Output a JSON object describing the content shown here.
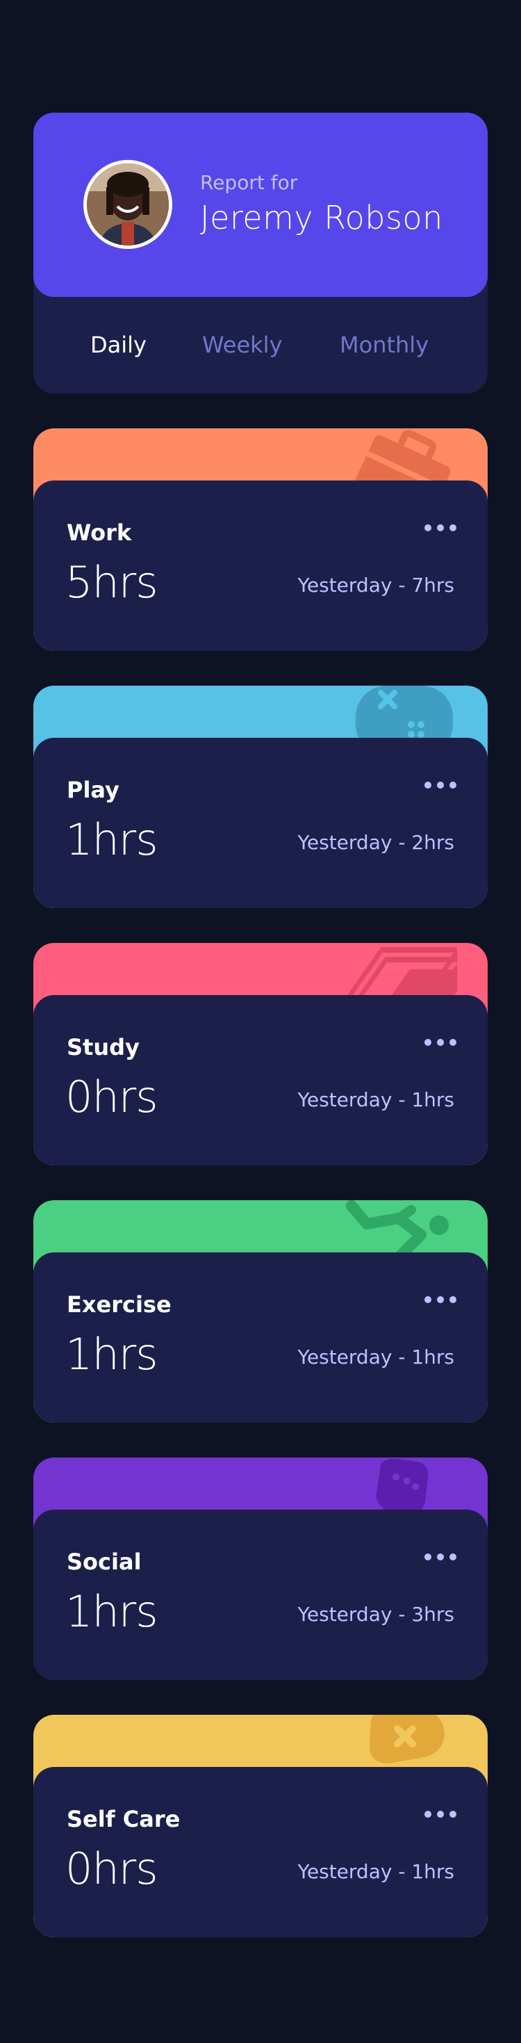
{
  "profile": {
    "report_label": "Report for",
    "name": "Jeremy Robson",
    "avatar_icon": "user-photo"
  },
  "tabs": [
    {
      "label": "Daily",
      "active": true
    },
    {
      "label": "Weekly",
      "active": false
    },
    {
      "label": "Monthly",
      "active": false
    }
  ],
  "menu_icon": "ellipsis-icon",
  "cards": [
    {
      "title": "Work",
      "current": "5hrs",
      "previous": "Yesterday - 7hrs",
      "color": "#ff8b64",
      "icon_color": "#e66e4a",
      "icon": "briefcase-icon"
    },
    {
      "title": "Play",
      "current": "1hrs",
      "previous": "Yesterday - 2hrs",
      "color": "#55c2e6",
      "icon_color": "#3f9ec2",
      "icon": "gamepad-icon"
    },
    {
      "title": "Study",
      "current": "0hrs",
      "previous": "Yesterday - 1hrs",
      "color": "#ff5e7d",
      "icon_color": "#e04866",
      "icon": "book-icon"
    },
    {
      "title": "Exercise",
      "current": "1hrs",
      "previous": "Yesterday - 1hrs",
      "color": "#4bcf82",
      "icon_color": "#2fa865",
      "icon": "running-icon"
    },
    {
      "title": "Social",
      "current": "1hrs",
      "previous": "Yesterday - 3hrs",
      "color": "#7335d2",
      "icon_color": "#5a20ad",
      "icon": "chat-icon"
    },
    {
      "title": "Self Care",
      "current": "0hrs",
      "previous": "Yesterday - 1hrs",
      "color": "#f1c75b",
      "icon_color": "#e2a83a",
      "icon": "heart-plus-icon"
    }
  ]
}
